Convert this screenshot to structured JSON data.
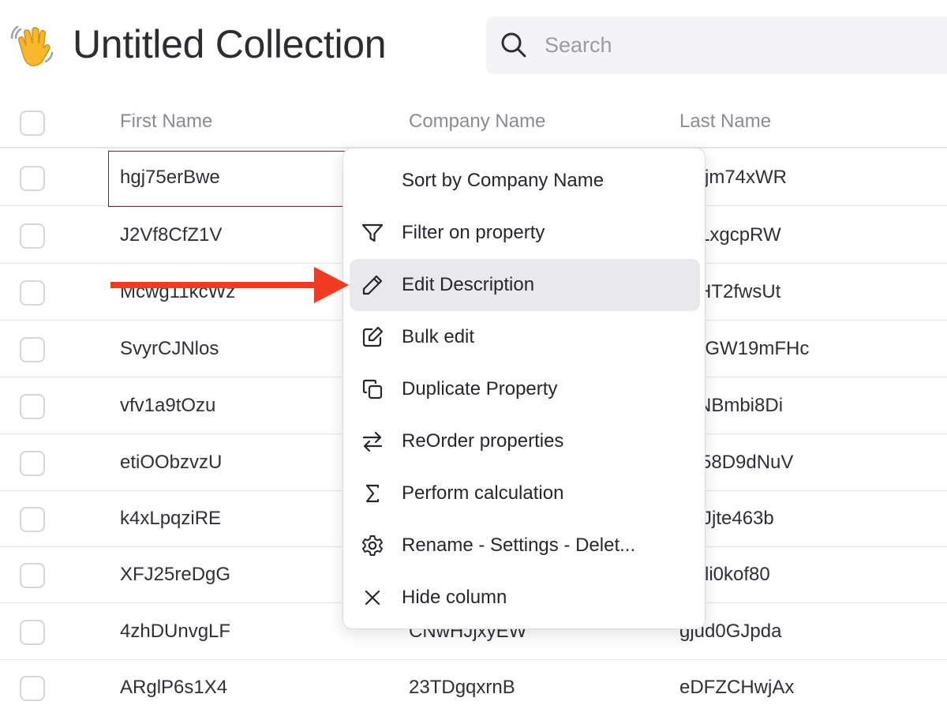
{
  "header": {
    "title": "Untitled Collection",
    "emoji": "waving-hand-icon",
    "search": {
      "placeholder": "Search",
      "value": ""
    }
  },
  "table": {
    "columns": [
      "First Name",
      "Company Name",
      "Last Name"
    ],
    "rows": [
      {
        "first": "hgj75erBwe",
        "company": "",
        "last": "jm74xWR"
      },
      {
        "first": "J2Vf8CfZ1V",
        "company": "",
        "last": "LxgcpRW"
      },
      {
        "first": "Mcwg11kcWz",
        "company": "",
        "last": "HT2fwsUt"
      },
      {
        "first": "SvyrCJNlos",
        "company": "",
        "last": "gGW19mFHc"
      },
      {
        "first": "vfv1a9tOzu",
        "company": "",
        "last": "NBmbi8Di"
      },
      {
        "first": "etiOObzvzU",
        "company": "",
        "last": "58D9dNuV"
      },
      {
        "first": "k4xLpqziRE",
        "company": "",
        "last": "Jjte463b"
      },
      {
        "first": "XFJ25reDgG",
        "company": "",
        "last": "li0kof80"
      },
      {
        "first": "4zhDUnvgLF",
        "company": "CNwHJjxyEW",
        "last": "gjud0GJpda"
      },
      {
        "first": "ARglP6s1X4",
        "company": "23TDgqxrnB",
        "last": "eDFZCHwjAx"
      }
    ]
  },
  "context_menu": {
    "items": [
      {
        "label": "Sort by Company Name",
        "icon": ""
      },
      {
        "label": "Filter on property",
        "icon": "filter-icon"
      },
      {
        "label": "Edit Description",
        "icon": "pencil-icon",
        "highlighted": true
      },
      {
        "label": "Bulk edit",
        "icon": "edit-square-icon"
      },
      {
        "label": "Duplicate Property",
        "icon": "copy-icon"
      },
      {
        "label": "ReOrder properties",
        "icon": "swap-arrows-icon"
      },
      {
        "label": "Perform calculation",
        "icon": "sigma-icon"
      },
      {
        "label": "Rename - Settings - Delet...",
        "icon": "gear-icon"
      },
      {
        "label": "Hide column",
        "icon": "close-icon"
      }
    ]
  },
  "annotation": {
    "arrow_color": "#f03a24"
  }
}
